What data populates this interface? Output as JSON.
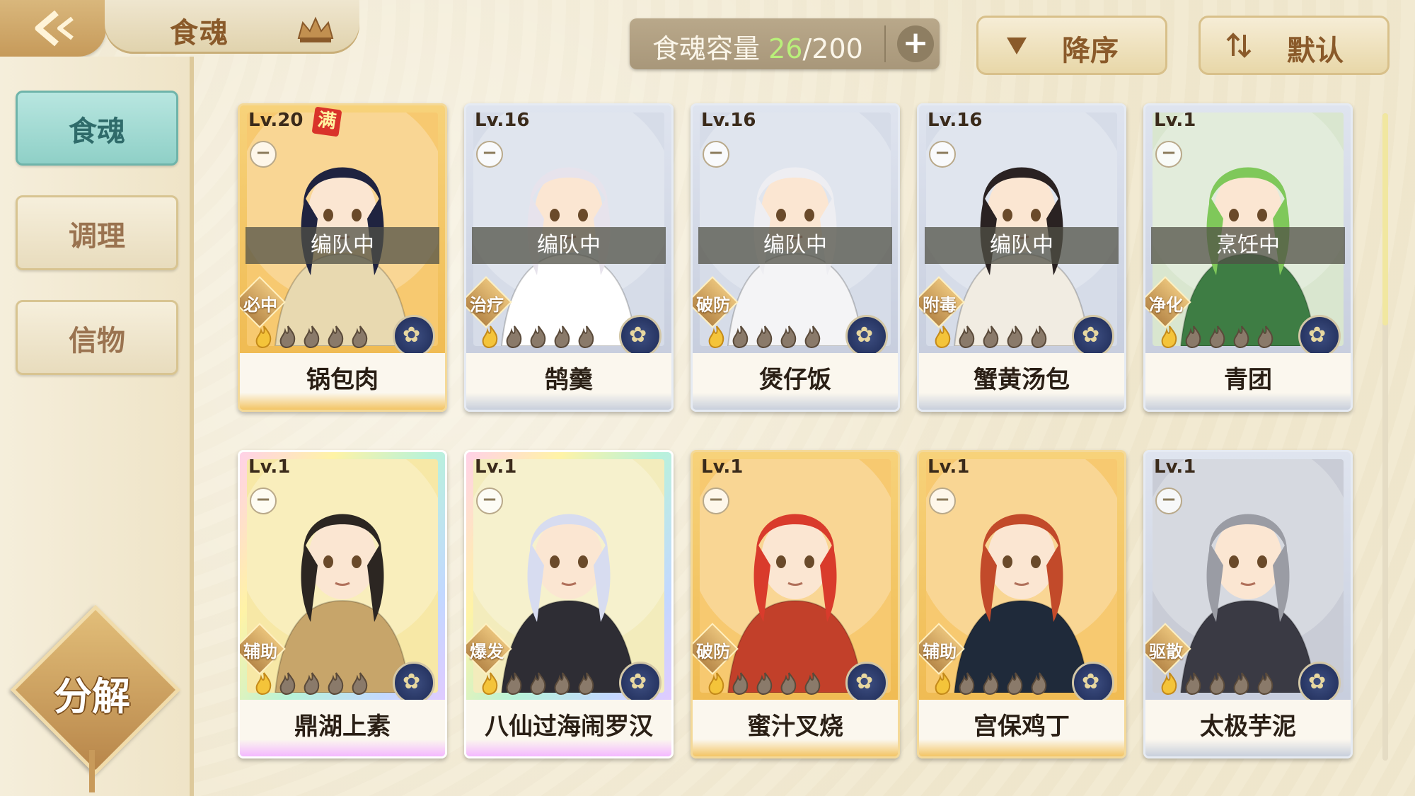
{
  "header": {
    "title": "食魂",
    "capacity_label": "食魂容量",
    "capacity_current": "26",
    "capacity_total": "/200",
    "sort_order_label": "降序",
    "sort_mode_label": "默认",
    "icons": {
      "back": "back-arrow-icon",
      "crown": "crown-icon",
      "add": "plus-icon",
      "sort_order": "triangle-down-icon",
      "sort_mode": "swap-arrows-icon"
    }
  },
  "sidebar": {
    "items": [
      {
        "label": "食魂",
        "active": true
      },
      {
        "label": "调理",
        "active": false
      },
      {
        "label": "信物",
        "active": false
      }
    ],
    "decompose_label": "分解"
  },
  "cards": [
    {
      "level": "Lv.20",
      "full": "满",
      "status": "编队中",
      "role": "必中",
      "name": "锅包肉",
      "frame": "gold",
      "stars": 1,
      "hair": "#1f2340",
      "outfit": "#e8d9b0",
      "bg": "#f7c970"
    },
    {
      "level": "Lv.16",
      "full": "",
      "status": "编队中",
      "role": "治疗",
      "name": "鹄羹",
      "frame": "silver",
      "stars": 1,
      "hair": "#e7e3ec",
      "outfit": "#ffffff",
      "bg": "#d6dce8"
    },
    {
      "level": "Lv.16",
      "full": "",
      "status": "编队中",
      "role": "破防",
      "name": "煲仔饭",
      "frame": "silver",
      "stars": 1,
      "hair": "#eeeef2",
      "outfit": "#f4f4f6",
      "bg": "#d6dce8"
    },
    {
      "level": "Lv.16",
      "full": "",
      "status": "编队中",
      "role": "附毒",
      "name": "蟹黄汤包",
      "frame": "silver",
      "stars": 1,
      "hair": "#2a2222",
      "outfit": "#f1ece2",
      "bg": "#d6dce8"
    },
    {
      "level": "Lv.1",
      "full": "",
      "status": "烹饪中",
      "role": "净化",
      "name": "青团",
      "frame": "silver",
      "stars": 1,
      "hair": "#7fc85a",
      "outfit": "#3e7d44",
      "bg": "#d9e6cf"
    },
    {
      "level": "Lv.1",
      "full": "",
      "status": "",
      "role": "辅助",
      "name": "鼎湖上素",
      "frame": "rainbow",
      "stars": 1,
      "hair": "#2c2622",
      "outfit": "#c7a56a",
      "bg": "#f7e8a6"
    },
    {
      "level": "Lv.1",
      "full": "",
      "status": "",
      "role": "爆发",
      "name": "八仙过海闹罗汉",
      "frame": "rainbow",
      "stars": 1,
      "hair": "#d7dcf0",
      "outfit": "#2e2d34",
      "bg": "#f3ecbc"
    },
    {
      "level": "Lv.1",
      "full": "",
      "status": "",
      "role": "破防",
      "name": "蜜汁叉烧",
      "frame": "gold",
      "stars": 1,
      "hair": "#d93b2c",
      "outfit": "#c2402a",
      "bg": "#f7c970"
    },
    {
      "level": "Lv.1",
      "full": "",
      "status": "",
      "role": "辅助",
      "name": "宫保鸡丁",
      "frame": "gold",
      "stars": 1,
      "hair": "#c24a2a",
      "outfit": "#1f2a3a",
      "bg": "#f7c970"
    },
    {
      "level": "Lv.1",
      "full": "",
      "status": "",
      "role": "驱散",
      "name": "太极芋泥",
      "frame": "silver",
      "stars": 1,
      "hair": "#9a9ca4",
      "outfit": "#3a3a44",
      "bg": "#c9ccd6"
    }
  ]
}
